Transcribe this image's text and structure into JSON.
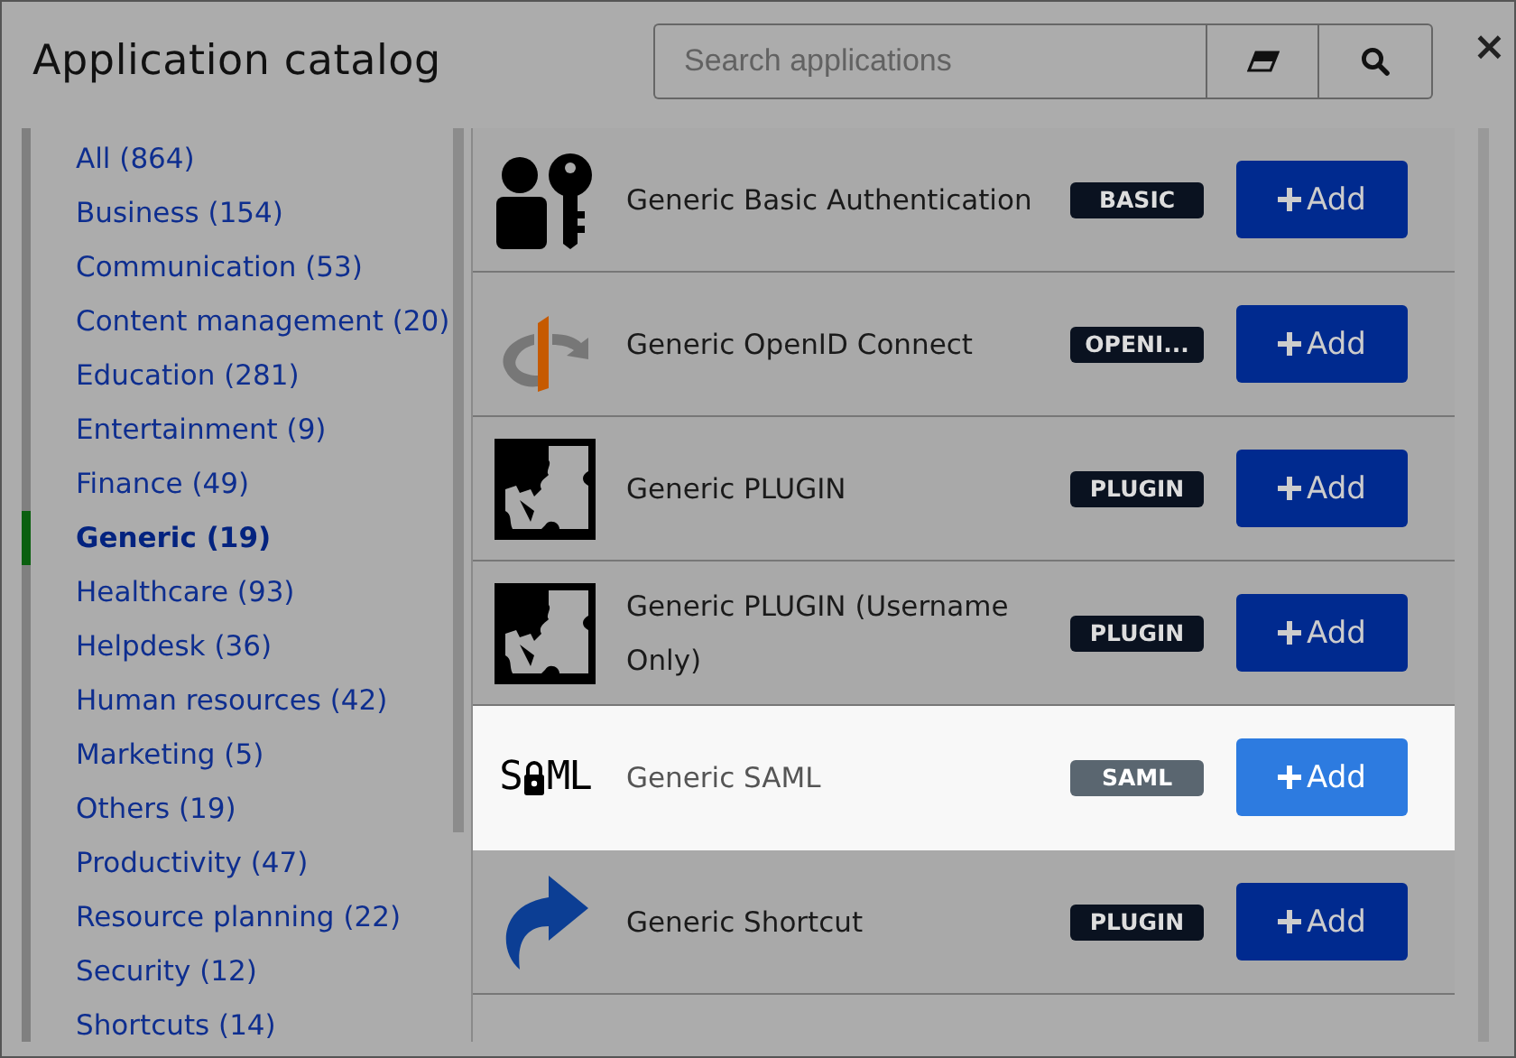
{
  "window": {
    "title": "Application catalog"
  },
  "search": {
    "placeholder": "Search applications"
  },
  "close": "×",
  "categories": [
    {
      "label": "All (864)",
      "selected": false
    },
    {
      "label": "Business (154)",
      "selected": false
    },
    {
      "label": "Communication (53)",
      "selected": false
    },
    {
      "label": "Content management (20)",
      "selected": false
    },
    {
      "label": "Education (281)",
      "selected": false
    },
    {
      "label": "Entertainment (9)",
      "selected": false
    },
    {
      "label": "Finance (49)",
      "selected": false
    },
    {
      "label": "Generic (19)",
      "selected": true
    },
    {
      "label": "Healthcare (93)",
      "selected": false
    },
    {
      "label": "Helpdesk (36)",
      "selected": false
    },
    {
      "label": "Human resources (42)",
      "selected": false
    },
    {
      "label": "Marketing (5)",
      "selected": false
    },
    {
      "label": "Others (19)",
      "selected": false
    },
    {
      "label": "Productivity (47)",
      "selected": false
    },
    {
      "label": "Resource planning (22)",
      "selected": false
    },
    {
      "label": "Security (12)",
      "selected": false
    },
    {
      "label": "Shortcuts (14)",
      "selected": false
    }
  ],
  "apps": [
    {
      "kind": "user-key",
      "name": "Generic Basic Authentication",
      "badge": "BASIC",
      "button": "Add",
      "highlighted": false
    },
    {
      "kind": "openid",
      "name": "Generic OpenID Connect",
      "badge": "OPENI...",
      "button": "Add",
      "highlighted": false
    },
    {
      "kind": "plugin",
      "name": "Generic PLUGIN",
      "badge": "PLUGIN",
      "button": "Add",
      "highlighted": false
    },
    {
      "kind": "plugin",
      "name": "Generic PLUGIN (Username Only)",
      "badge": "PLUGIN",
      "button": "Add",
      "highlighted": false
    },
    {
      "kind": "saml",
      "logo_text": [
        "S",
        "ML"
      ],
      "name": "Generic SAML",
      "badge": "SAML",
      "button": "Add",
      "highlighted": true
    },
    {
      "kind": "shortcut",
      "name": "Generic Shortcut",
      "badge": "PLUGIN",
      "button": "Add",
      "highlighted": false
    }
  ]
}
